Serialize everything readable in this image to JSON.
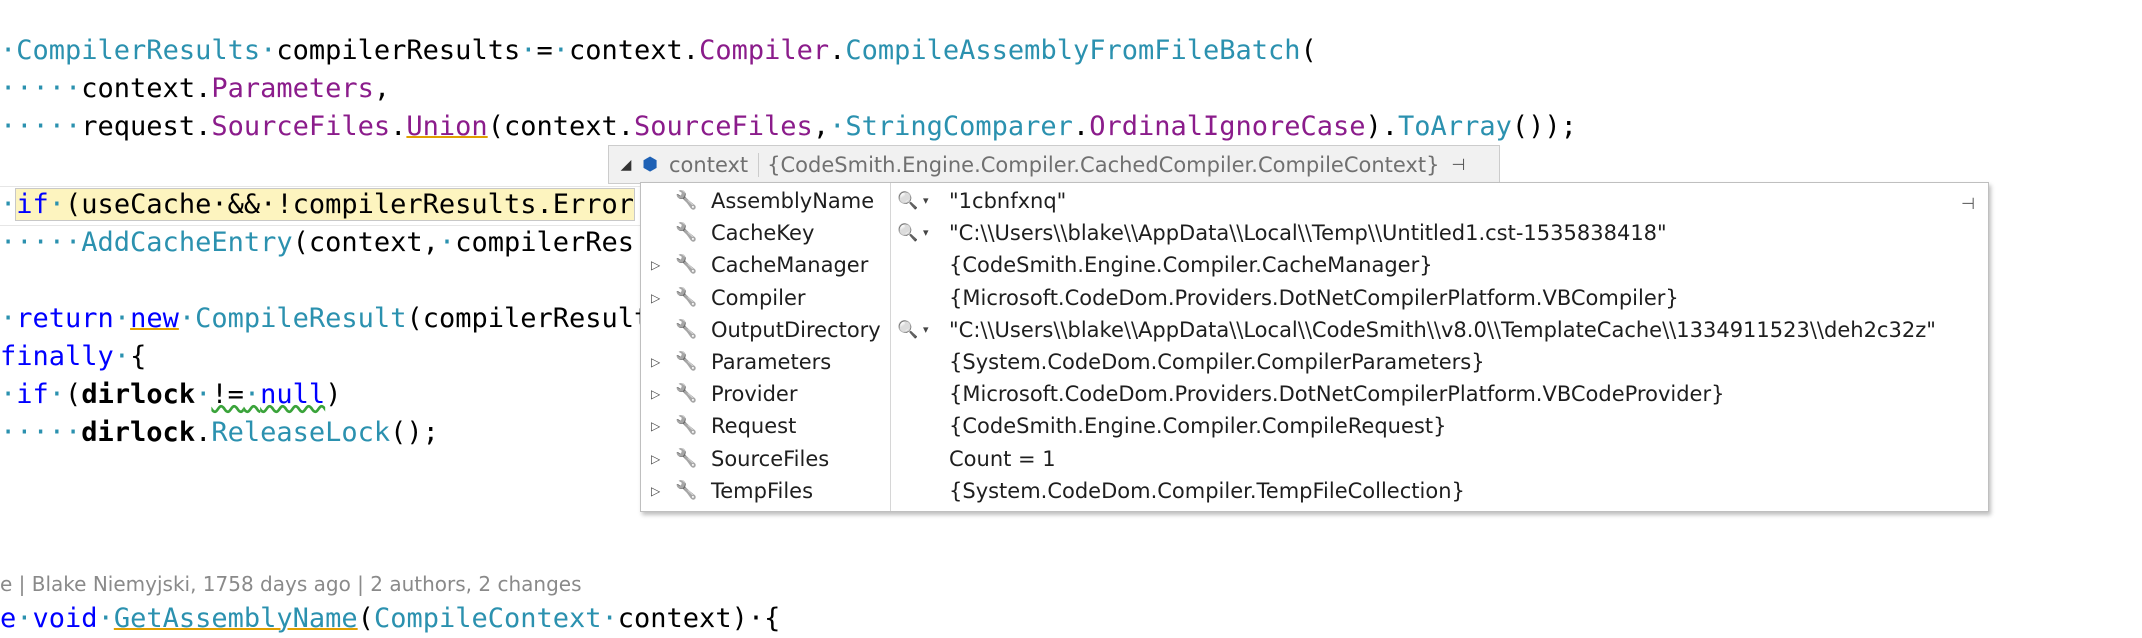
{
  "editor": {
    "lines": {
      "l1": {
        "ws": "·",
        "type": "CompilerResults",
        "ws2": "·",
        "var": "compilerResults",
        "ws3": "·",
        "op": "=",
        "ws4": "·",
        "ctx": "context.",
        "prop1": "Compiler",
        "dot": ".",
        "method": "CompileAssemblyFromFileBatch",
        "paren": "("
      },
      "l2": {
        "ws": "·····",
        "ctx": "context.",
        "prop": "Parameters",
        "tail": ","
      },
      "l3": {
        "ws": "·····",
        "req": "request.",
        "prop1": "SourceFiles",
        "dot": ".",
        "m1": "Union",
        "p1": "(context.",
        "prop2": "SourceFiles",
        "comma": ",",
        "ws2": "·",
        "type": "StringComparer",
        "dot2": ".",
        "prop3": "OrdinalIgnoreCase",
        "p2": ").",
        "m2": "ToArray",
        "tail": "());"
      },
      "l4": {
        "ws": "·",
        "kw": "if",
        "ws2": "·",
        "rest": "(useCache·&&·!compilerResults.Error"
      },
      "l5": {
        "ws": "·····",
        "m": "AddCacheEntry",
        "rest": "(context,",
        "ws2": "·",
        "tail": "compilerRes"
      },
      "l6": {
        "ws": "·",
        "kw1": "return",
        "ws2": "·",
        "kw2": "new",
        "ws3": "·",
        "type": "CompileResult",
        "tail": "(compilerResult"
      },
      "l7": {
        "kw": "finally",
        "ws": "·",
        "tail": "{"
      },
      "l8": {
        "ws": "·",
        "kw": "if",
        "ws2": "·",
        "p": "(",
        "var": "dirlock",
        "ws3": "·",
        "op": "!=",
        "ws4": "·",
        "kw2": "null",
        "tail": ")"
      },
      "l9": {
        "ws": "·····",
        "var": "dirlock",
        "dot": ".",
        "m": "ReleaseLock",
        "tail": "();"
      },
      "l10": {
        "kw1": "e",
        "ws": "·",
        "kw2": "void",
        "ws2": "·",
        "m": "GetAssemblyName",
        "p": "(",
        "type": "CompileContext",
        "ws3": "·",
        "tail": "context)·{"
      }
    },
    "codelens": {
      "prefix": "e",
      "sep1": " | ",
      "author": "Blake Niemyjski, 1758 days ago",
      "sep2": " | ",
      "changes": "2 authors, 2 changes"
    }
  },
  "datatip": {
    "header": {
      "name": "context",
      "value": "{CodeSmith.Engine.Compiler.CachedCompiler.CompileContext}",
      "expander_icon": "collapse-arrow",
      "object_icon": "object-icon",
      "pin_icon": "pin-icon"
    },
    "rows": [
      {
        "name": "AssemblyName",
        "value": "\"1cbnfxnq\"",
        "expandable": false,
        "visualizer": true,
        "pinned": true
      },
      {
        "name": "CacheKey",
        "value": "\"C:\\\\Users\\\\blake\\\\AppData\\\\Local\\\\Temp\\\\Untitled1.cst-1535838418\"",
        "expandable": false,
        "visualizer": true
      },
      {
        "name": "CacheManager",
        "value": "{CodeSmith.Engine.Compiler.CacheManager}",
        "expandable": true,
        "visualizer": false
      },
      {
        "name": "Compiler",
        "value": "{Microsoft.CodeDom.Providers.DotNetCompilerPlatform.VBCompiler}",
        "expandable": true,
        "visualizer": false
      },
      {
        "name": "OutputDirectory",
        "value": "\"C:\\\\Users\\\\blake\\\\AppData\\\\Local\\\\CodeSmith\\\\v8.0\\\\TemplateCache\\\\1334911523\\\\deh2c32z\"",
        "expandable": false,
        "visualizer": true
      },
      {
        "name": "Parameters",
        "value": "{System.CodeDom.Compiler.CompilerParameters}",
        "expandable": true,
        "visualizer": false
      },
      {
        "name": "Provider",
        "value": "{Microsoft.CodeDom.Providers.DotNetCompilerPlatform.VBCodeProvider}",
        "expandable": true,
        "visualizer": false
      },
      {
        "name": "Request",
        "value": "{CodeSmith.Engine.Compiler.CompileRequest}",
        "expandable": true,
        "visualizer": false
      },
      {
        "name": "SourceFiles",
        "value": "Count = 1",
        "expandable": true,
        "visualizer": false
      },
      {
        "name": "TempFiles",
        "value": "{System.CodeDom.Compiler.TempFileCollection}",
        "expandable": true,
        "visualizer": false
      }
    ],
    "glyphs": {
      "expand": "▷",
      "collapse": "◢",
      "wrench": "🔧",
      "search": "🔍",
      "dropdown": "▾",
      "pin": "⊣",
      "object": "⬢"
    }
  }
}
